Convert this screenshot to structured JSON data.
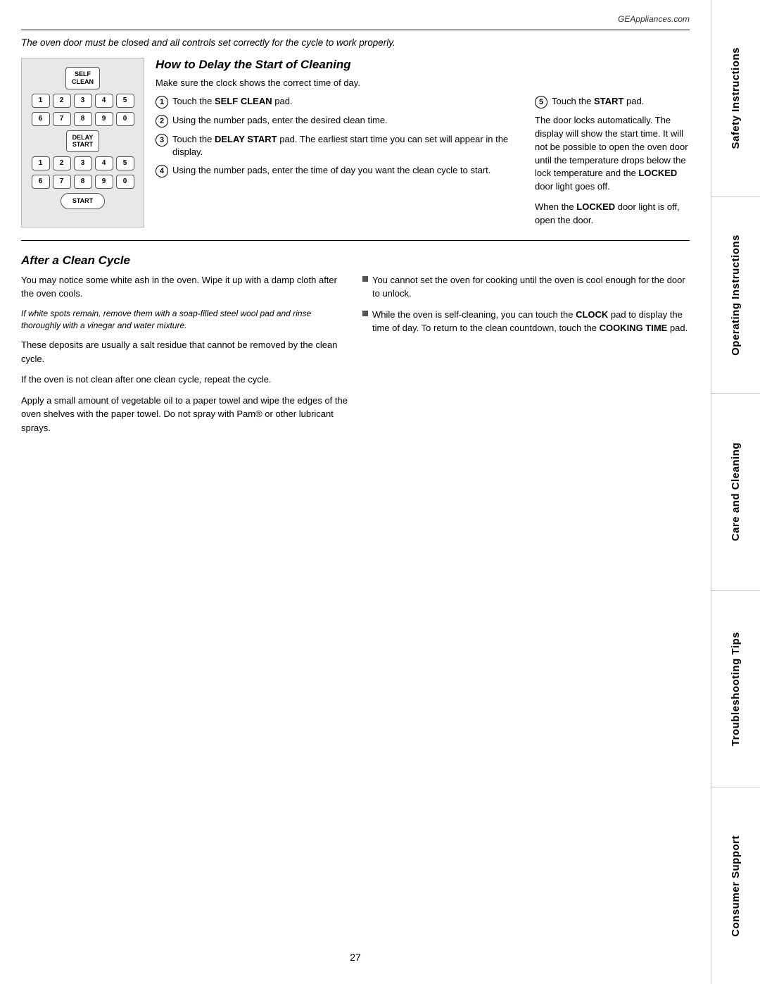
{
  "header": {
    "website": "GEAppliances.com"
  },
  "intro": "The oven door must be closed and all controls set correctly for the cycle to work properly.",
  "how_to_section": {
    "title": "How to Delay the Start of Cleaning",
    "intro": "Make sure the clock shows the correct time of day.",
    "steps": [
      {
        "num": "1",
        "text_parts": [
          {
            "text": "Touch the ",
            "bold": false
          },
          {
            "text": "SELF CLEAN",
            "bold": true
          },
          {
            "text": " pad.",
            "bold": false
          }
        ]
      },
      {
        "num": "2",
        "text": "Using the number pads, enter the desired clean time."
      },
      {
        "num": "3",
        "text_parts": [
          {
            "text": "Touch the ",
            "bold": false
          },
          {
            "text": "DELAY START",
            "bold": true
          },
          {
            "text": " pad. The earliest start time you can set will appear in the display.",
            "bold": false
          }
        ]
      },
      {
        "num": "4",
        "text": "Using the number pads, enter the time of day you want the clean cycle to start."
      },
      {
        "num": "5",
        "text_parts": [
          {
            "text": "Touch the ",
            "bold": false
          },
          {
            "text": "START",
            "bold": true
          },
          {
            "text": " pad.",
            "bold": false
          }
        ]
      }
    ],
    "step5_followup_1": "The door locks automatically. The display will show the start time. It will not be possible to open the oven door until the temperature drops below the lock temperature and the",
    "step5_followup_1b": "LOCKED",
    "step5_followup_1c": "door light goes off.",
    "step5_followup_2": "When the",
    "step5_followup_2b": "LOCKED",
    "step5_followup_2c": "door light is off, open the door."
  },
  "after_section": {
    "title": "After a Clean Cycle",
    "left_paras": [
      "You may notice some white ash in the oven. Wipe it up with a damp cloth after the oven cools.",
      "If white spots remain, remove them with a soap-filled steel wool pad and rinse thoroughly with a vinegar and water mixture.",
      "These deposits are usually a salt residue that cannot be removed by the clean cycle.",
      "If the oven is not clean after one clean cycle, repeat the cycle.",
      "Apply a small amount of vegetable oil to a paper towel and wipe the edges of the oven shelves with the paper towel. Do not spray with Pam® or other lubricant sprays."
    ],
    "right_bullets": [
      "You cannot set the oven for cooking until the oven is cool enough for the door to unlock.",
      "While the oven is self-cleaning, you can touch the CLOCK pad to display the time of day. To return to the clean countdown, touch the COOKING TIME pad."
    ]
  },
  "sidebar": {
    "tabs": [
      "Safety Instructions",
      "Operating Instructions",
      "Care and Cleaning",
      "Troubleshooting Tips",
      "Consumer Support"
    ]
  },
  "page_number": "27",
  "keypad": {
    "self_clean": "SELF\nCLEAN",
    "row1": [
      "1",
      "2",
      "3",
      "4",
      "5"
    ],
    "row2": [
      "6",
      "7",
      "8",
      "9",
      "0"
    ],
    "delay_start": "DELAY\nSTART",
    "row3": [
      "1",
      "2",
      "3",
      "4",
      "5"
    ],
    "row4": [
      "6",
      "7",
      "8",
      "9",
      "0"
    ],
    "start": "START"
  }
}
